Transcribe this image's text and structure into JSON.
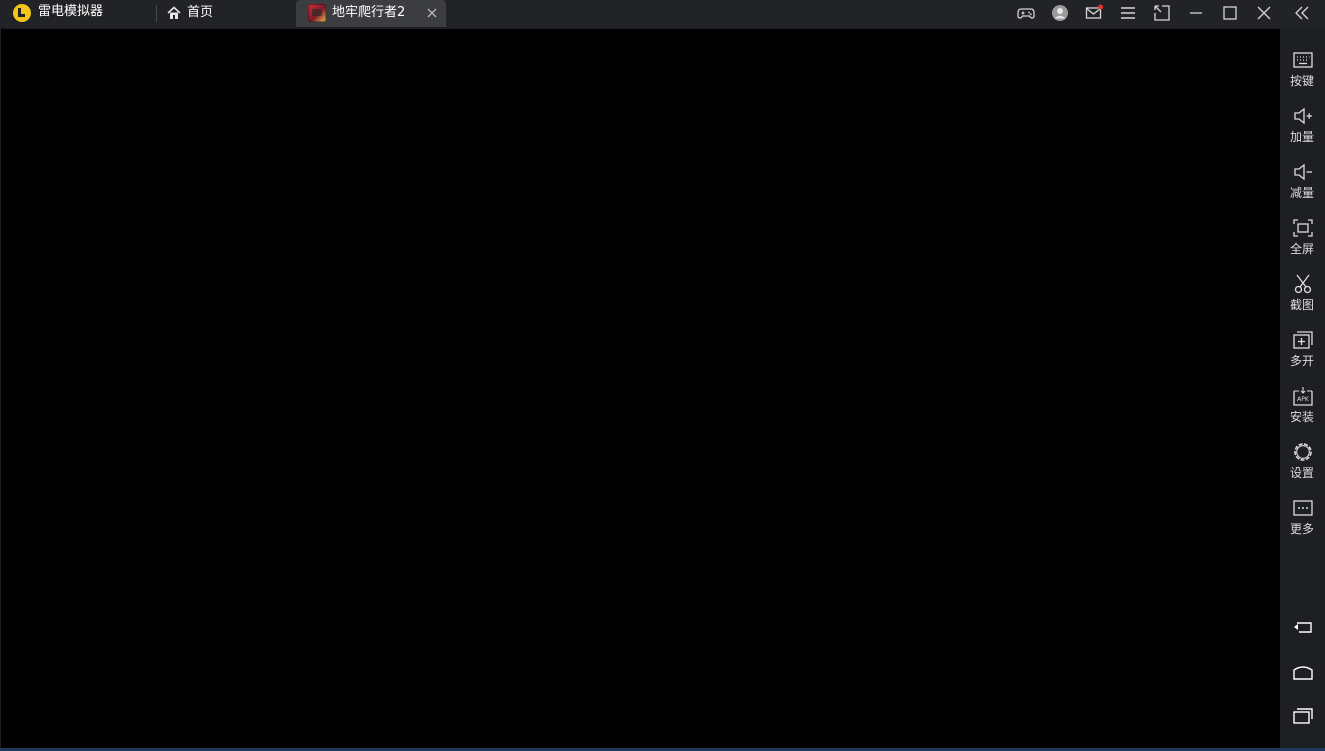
{
  "app": {
    "name": "雷电模拟器",
    "accent_color": "#f5c518"
  },
  "tabs": [
    {
      "label": "首页",
      "icon": "home-icon",
      "active": false
    },
    {
      "label": "地牢爬行者2",
      "icon": "game-icon",
      "active": true
    }
  ],
  "titlebar_buttons": [
    "gamepad-icon",
    "user-avatar-icon",
    "mail-icon",
    "menu-icon",
    "resize-window-icon",
    "minimize-icon",
    "maximize-icon",
    "close-icon",
    "collapse-sidebar-icon"
  ],
  "sidebar": {
    "items": [
      {
        "label": "按键",
        "icon": "keyboard-icon"
      },
      {
        "label": "加量",
        "icon": "volume-up-icon"
      },
      {
        "label": "减量",
        "icon": "volume-down-icon"
      },
      {
        "label": "全屏",
        "icon": "fullscreen-icon"
      },
      {
        "label": "截图",
        "icon": "scissors-icon"
      },
      {
        "label": "多开",
        "icon": "multi-instance-icon"
      },
      {
        "label": "安装",
        "icon": "apk-install-icon"
      },
      {
        "label": "设置",
        "icon": "gear-icon"
      },
      {
        "label": "更多",
        "icon": "more-icon"
      }
    ],
    "nav": [
      "back-icon",
      "home-nav-icon",
      "recent-apps-icon"
    ]
  },
  "colors": {
    "notification_dot": "#e0352b",
    "screen": "#000000"
  }
}
